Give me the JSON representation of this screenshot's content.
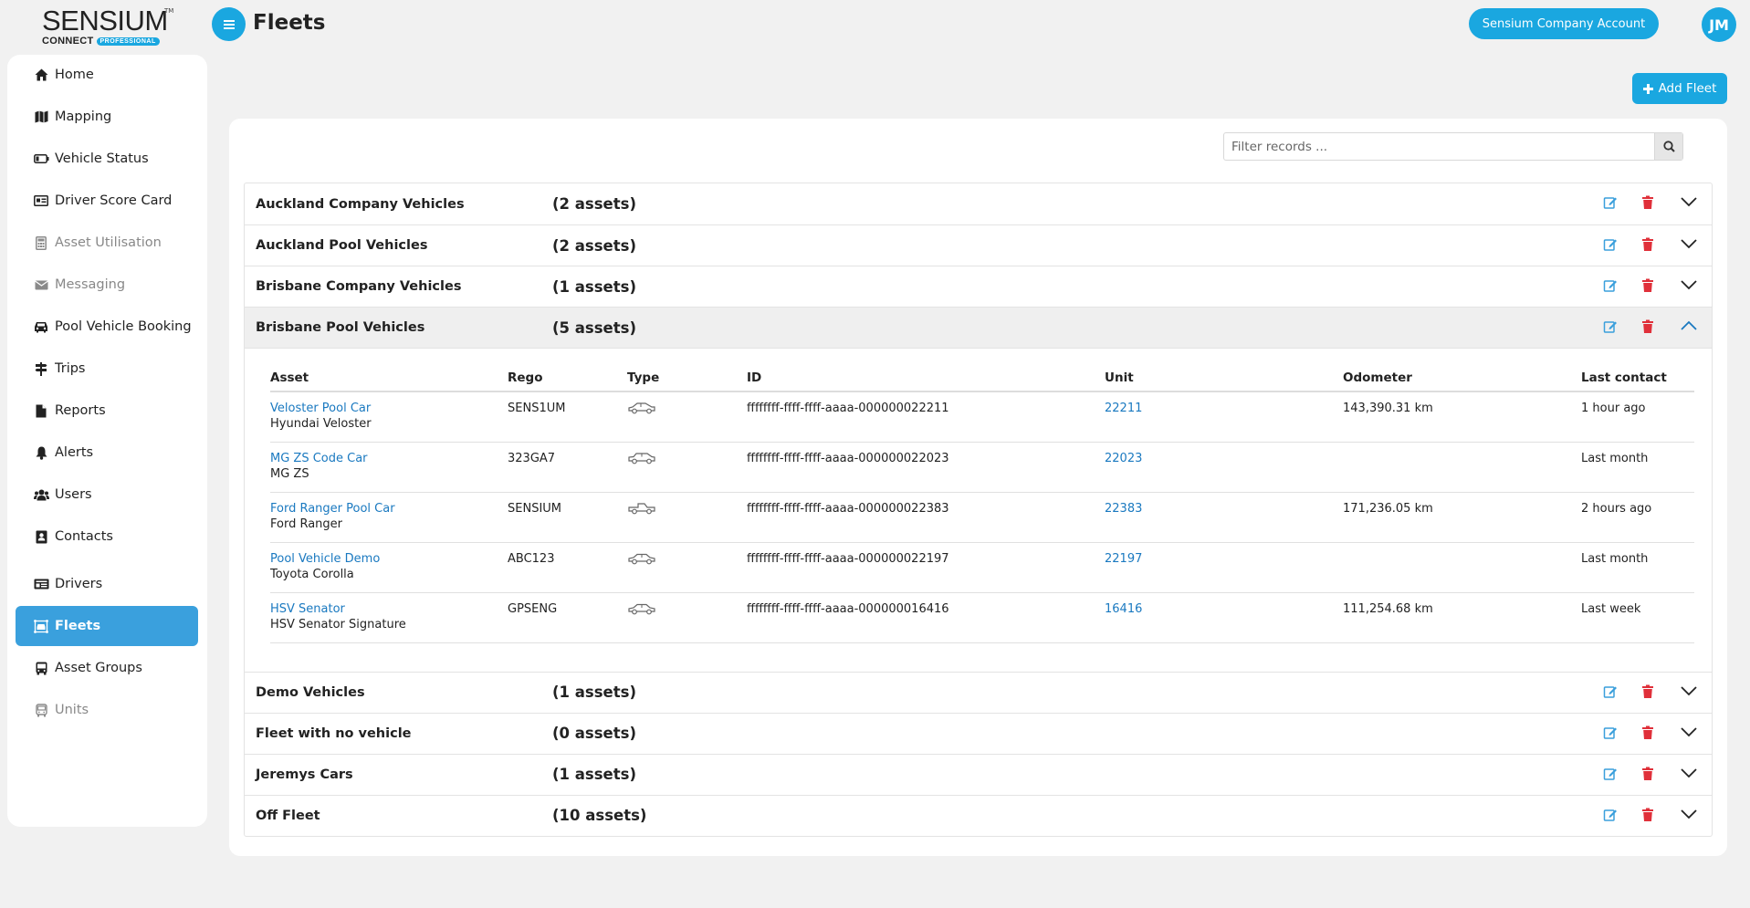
{
  "logo": {
    "brand": "SENSIUM",
    "connect": "CONNECT",
    "edition": "PROFESSIONAL",
    "tm": "TM"
  },
  "header": {
    "title": "Fleets",
    "account": "Sensium Company Account",
    "avatar": "JM"
  },
  "sidebar": {
    "items": [
      {
        "label": "Home",
        "icon": "home-icon",
        "state": "normal"
      },
      {
        "label": "Mapping",
        "icon": "map-icon",
        "state": "normal"
      },
      {
        "label": "Vehicle Status",
        "icon": "battery-icon",
        "state": "normal"
      },
      {
        "label": "Driver Score Card",
        "icon": "id-card-icon",
        "state": "normal"
      },
      {
        "label": "Asset Utilisation",
        "icon": "calculator-icon",
        "state": "disabled"
      },
      {
        "label": "Messaging",
        "icon": "envelope-icon",
        "state": "disabled"
      },
      {
        "label": "Pool Vehicle Booking",
        "icon": "car-icon",
        "state": "normal"
      },
      {
        "label": "Trips",
        "icon": "signpost-icon",
        "state": "normal"
      },
      {
        "label": "Reports",
        "icon": "file-icon",
        "state": "normal"
      },
      {
        "label": "Alerts",
        "icon": "bell-icon",
        "state": "normal"
      },
      {
        "label": "Users",
        "icon": "users-icon",
        "state": "normal"
      },
      {
        "label": "Contacts",
        "icon": "contact-book-icon",
        "state": "normal"
      },
      {
        "label": "Drivers",
        "icon": "driver-card-icon",
        "state": "normal"
      },
      {
        "label": "Fleets",
        "icon": "fleet-icon",
        "state": "active"
      },
      {
        "label": "Asset Groups",
        "icon": "bus-icon",
        "state": "normal"
      },
      {
        "label": "Units",
        "icon": "bus-outline-icon",
        "state": "disabled"
      }
    ]
  },
  "toolbar": {
    "add_fleet": "Add Fleet"
  },
  "filter": {
    "placeholder": "Filter records ..."
  },
  "fleets": [
    {
      "name": "Auckland Company Vehicles",
      "count": "(2 assets)"
    },
    {
      "name": "Auckland Pool Vehicles",
      "count": "(2 assets)"
    },
    {
      "name": "Brisbane Company Vehicles",
      "count": "(1 assets)"
    },
    {
      "name": "Brisbane Pool Vehicles",
      "count": "(5 assets)"
    },
    {
      "name": "Demo Vehicles",
      "count": "(1 assets)"
    },
    {
      "name": "Fleet with no vehicle",
      "count": "(0 assets)"
    },
    {
      "name": "Jeremys Cars",
      "count": "(1 assets)"
    },
    {
      "name": "Off Fleet",
      "count": "(10 assets)"
    }
  ],
  "asset_table": {
    "headers": {
      "asset": "Asset",
      "rego": "Rego",
      "type": "Type",
      "id": "ID",
      "unit": "Unit",
      "odometer": "Odometer",
      "last_contact": "Last contact"
    },
    "rows": [
      {
        "name": "Veloster Pool Car",
        "model": "Hyundai Veloster",
        "rego": "SENS1UM",
        "type_icon": "hatchback-icon",
        "id": "ffffffff-ffff-ffff-aaaa-000000022211",
        "unit": "22211",
        "odometer": "143,390.31 km",
        "last_contact": "1 hour ago"
      },
      {
        "name": "MG ZS Code Car",
        "model": "MG ZS",
        "rego": "323GA7",
        "type_icon": "suv-icon",
        "id": "ffffffff-ffff-ffff-aaaa-000000022023",
        "unit": "22023",
        "odometer": "",
        "last_contact": "Last month"
      },
      {
        "name": "Ford Ranger Pool Car",
        "model": "Ford Ranger",
        "rego": "SENSIUM",
        "type_icon": "ute-icon",
        "id": "ffffffff-ffff-ffff-aaaa-000000022383",
        "unit": "22383",
        "odometer": "171,236.05 km",
        "last_contact": "2 hours ago"
      },
      {
        "name": "Pool Vehicle Demo",
        "model": "Toyota Corolla",
        "rego": "ABC123",
        "type_icon": "sedan-icon",
        "id": "ffffffff-ffff-ffff-aaaa-000000022197",
        "unit": "22197",
        "odometer": "",
        "last_contact": "Last month"
      },
      {
        "name": "HSV Senator",
        "model": "HSV Senator Signature",
        "rego": "GPSENG",
        "type_icon": "sedan-icon",
        "id": "ffffffff-ffff-ffff-aaaa-000000016416",
        "unit": "16416",
        "odometer": "111,254.68 km",
        "last_contact": "Last week"
      }
    ]
  },
  "colors": {
    "accent": "#1aa7e0",
    "active_nav": "#3aa0dd",
    "link": "#1a79c0",
    "delete": "#e0303a",
    "edit": "#3a9fdc"
  }
}
